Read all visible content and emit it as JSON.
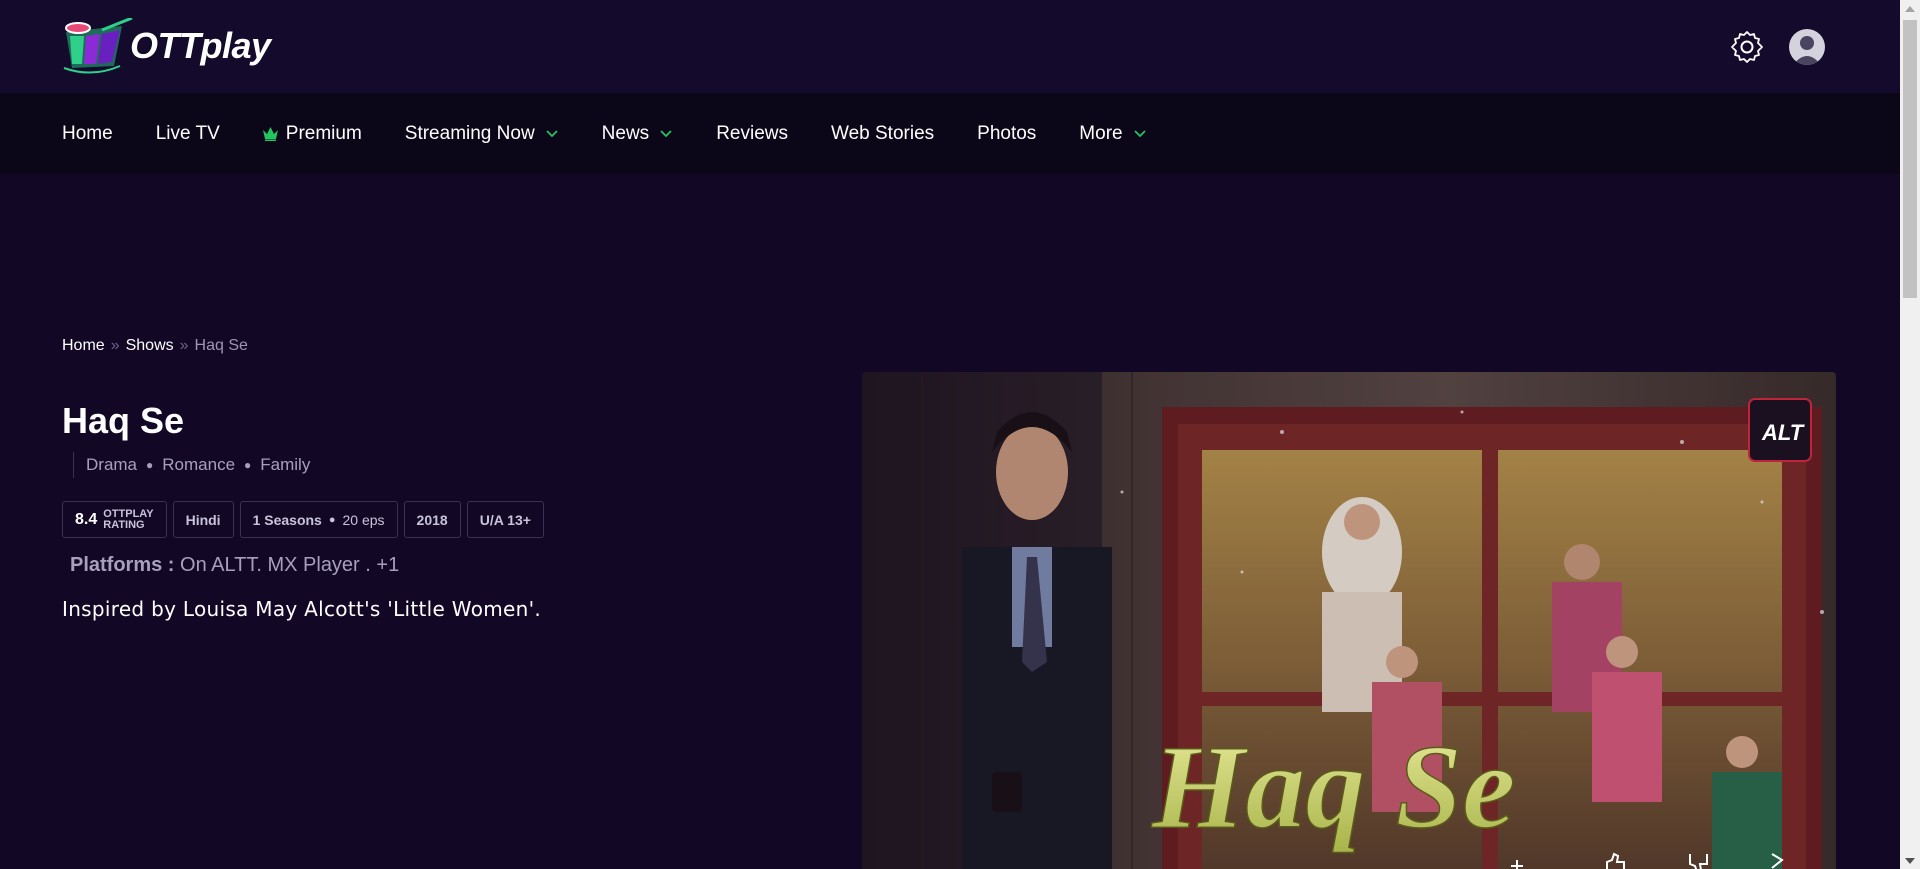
{
  "header": {
    "logo_text": "OTTplay"
  },
  "nav": {
    "items": [
      {
        "label": "Home"
      },
      {
        "label": "Live TV"
      },
      {
        "label": "Premium"
      },
      {
        "label": "Streaming Now"
      },
      {
        "label": "News"
      },
      {
        "label": "Reviews"
      },
      {
        "label": "Web Stories"
      },
      {
        "label": "Photos"
      },
      {
        "label": "More"
      }
    ]
  },
  "breadcrumb": {
    "home": "Home",
    "shows": "Shows",
    "current": "Haq Se",
    "separator": "»"
  },
  "show": {
    "title": "Haq Se",
    "genres": [
      "Drama",
      "Romance",
      "Family"
    ],
    "rating": "8.4",
    "rating_label_1": "OTTPLAY",
    "rating_label_2": "RATING",
    "language": "Hindi",
    "seasons": "1 Seasons",
    "episodes": "20 eps",
    "year": "2018",
    "certificate": "U/A 13+",
    "platforms_label": "Platforms :",
    "platforms_value": "On ALTT. MX Player . +1",
    "description": "Inspired by Louisa May Alcott's 'Little Women'.",
    "poster_title": "Haq Se",
    "poster_badge": "ALT"
  },
  "colors": {
    "background": "#120826",
    "topbar": "#140a2b",
    "nav": "#0c0619",
    "accent_green": "#22c55e",
    "muted_text": "#a7a0bd"
  }
}
